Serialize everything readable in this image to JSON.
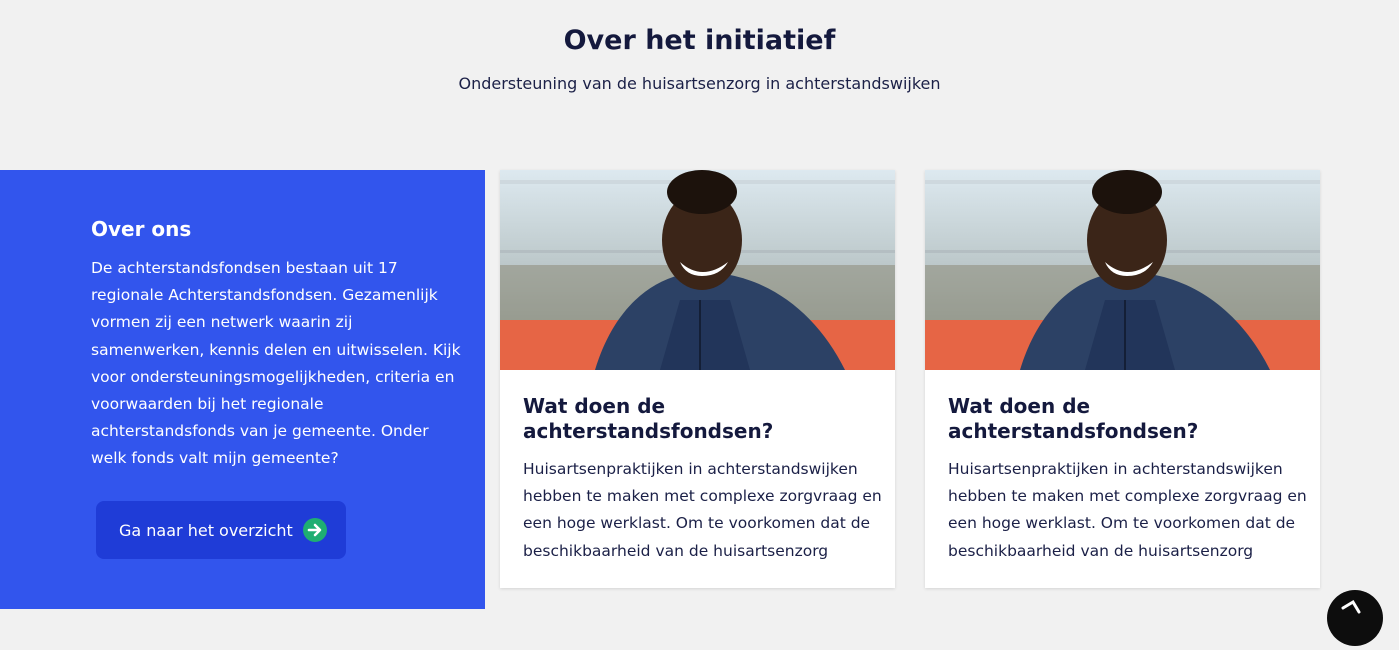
{
  "header": {
    "title": "Over het initiatief",
    "subtitle": "Ondersteuning van de huisartsenzorg in achterstandswijken"
  },
  "about": {
    "title": "Over ons",
    "text": "De achterstandsfondsen bestaan uit 17 regionale Achterstandsfondsen. Gezamenlijk vormen zij een netwerk waarin zij samenwerken, kennis delen en uitwisselen. Kijk voor ondersteuningsmogelijkheden, criteria en voorwaarden bij het regionale achterstandsfonds van je gemeente. Onder welk fonds valt mijn gemeente?",
    "button_label": "Ga naar het overzicht",
    "button_icon": "arrow-right-icon"
  },
  "cards": [
    {
      "title": "Wat doen de achterstandsfondsen?",
      "text": "Huisartsenpraktijken in achterstandswijken hebben te maken met complexe zorgvraag en een hoge werklast. Om te voorkomen dat de beschikbaarheid van de huisartsenzorg"
    },
    {
      "title": "Wat doen de achterstandsfondsen?",
      "text": "Huisartsenpraktijken in achterstandswijken hebben te maken met complexe zorgvraag en een hoge werklast. Om te voorkomen dat de beschikbaarheid van de huisartsenzorg"
    }
  ],
  "colors": {
    "accent_blue": "#3255ed",
    "button_blue": "#1f3cd7",
    "heading_navy": "#14193d",
    "arrow_green": "#1fae72"
  }
}
